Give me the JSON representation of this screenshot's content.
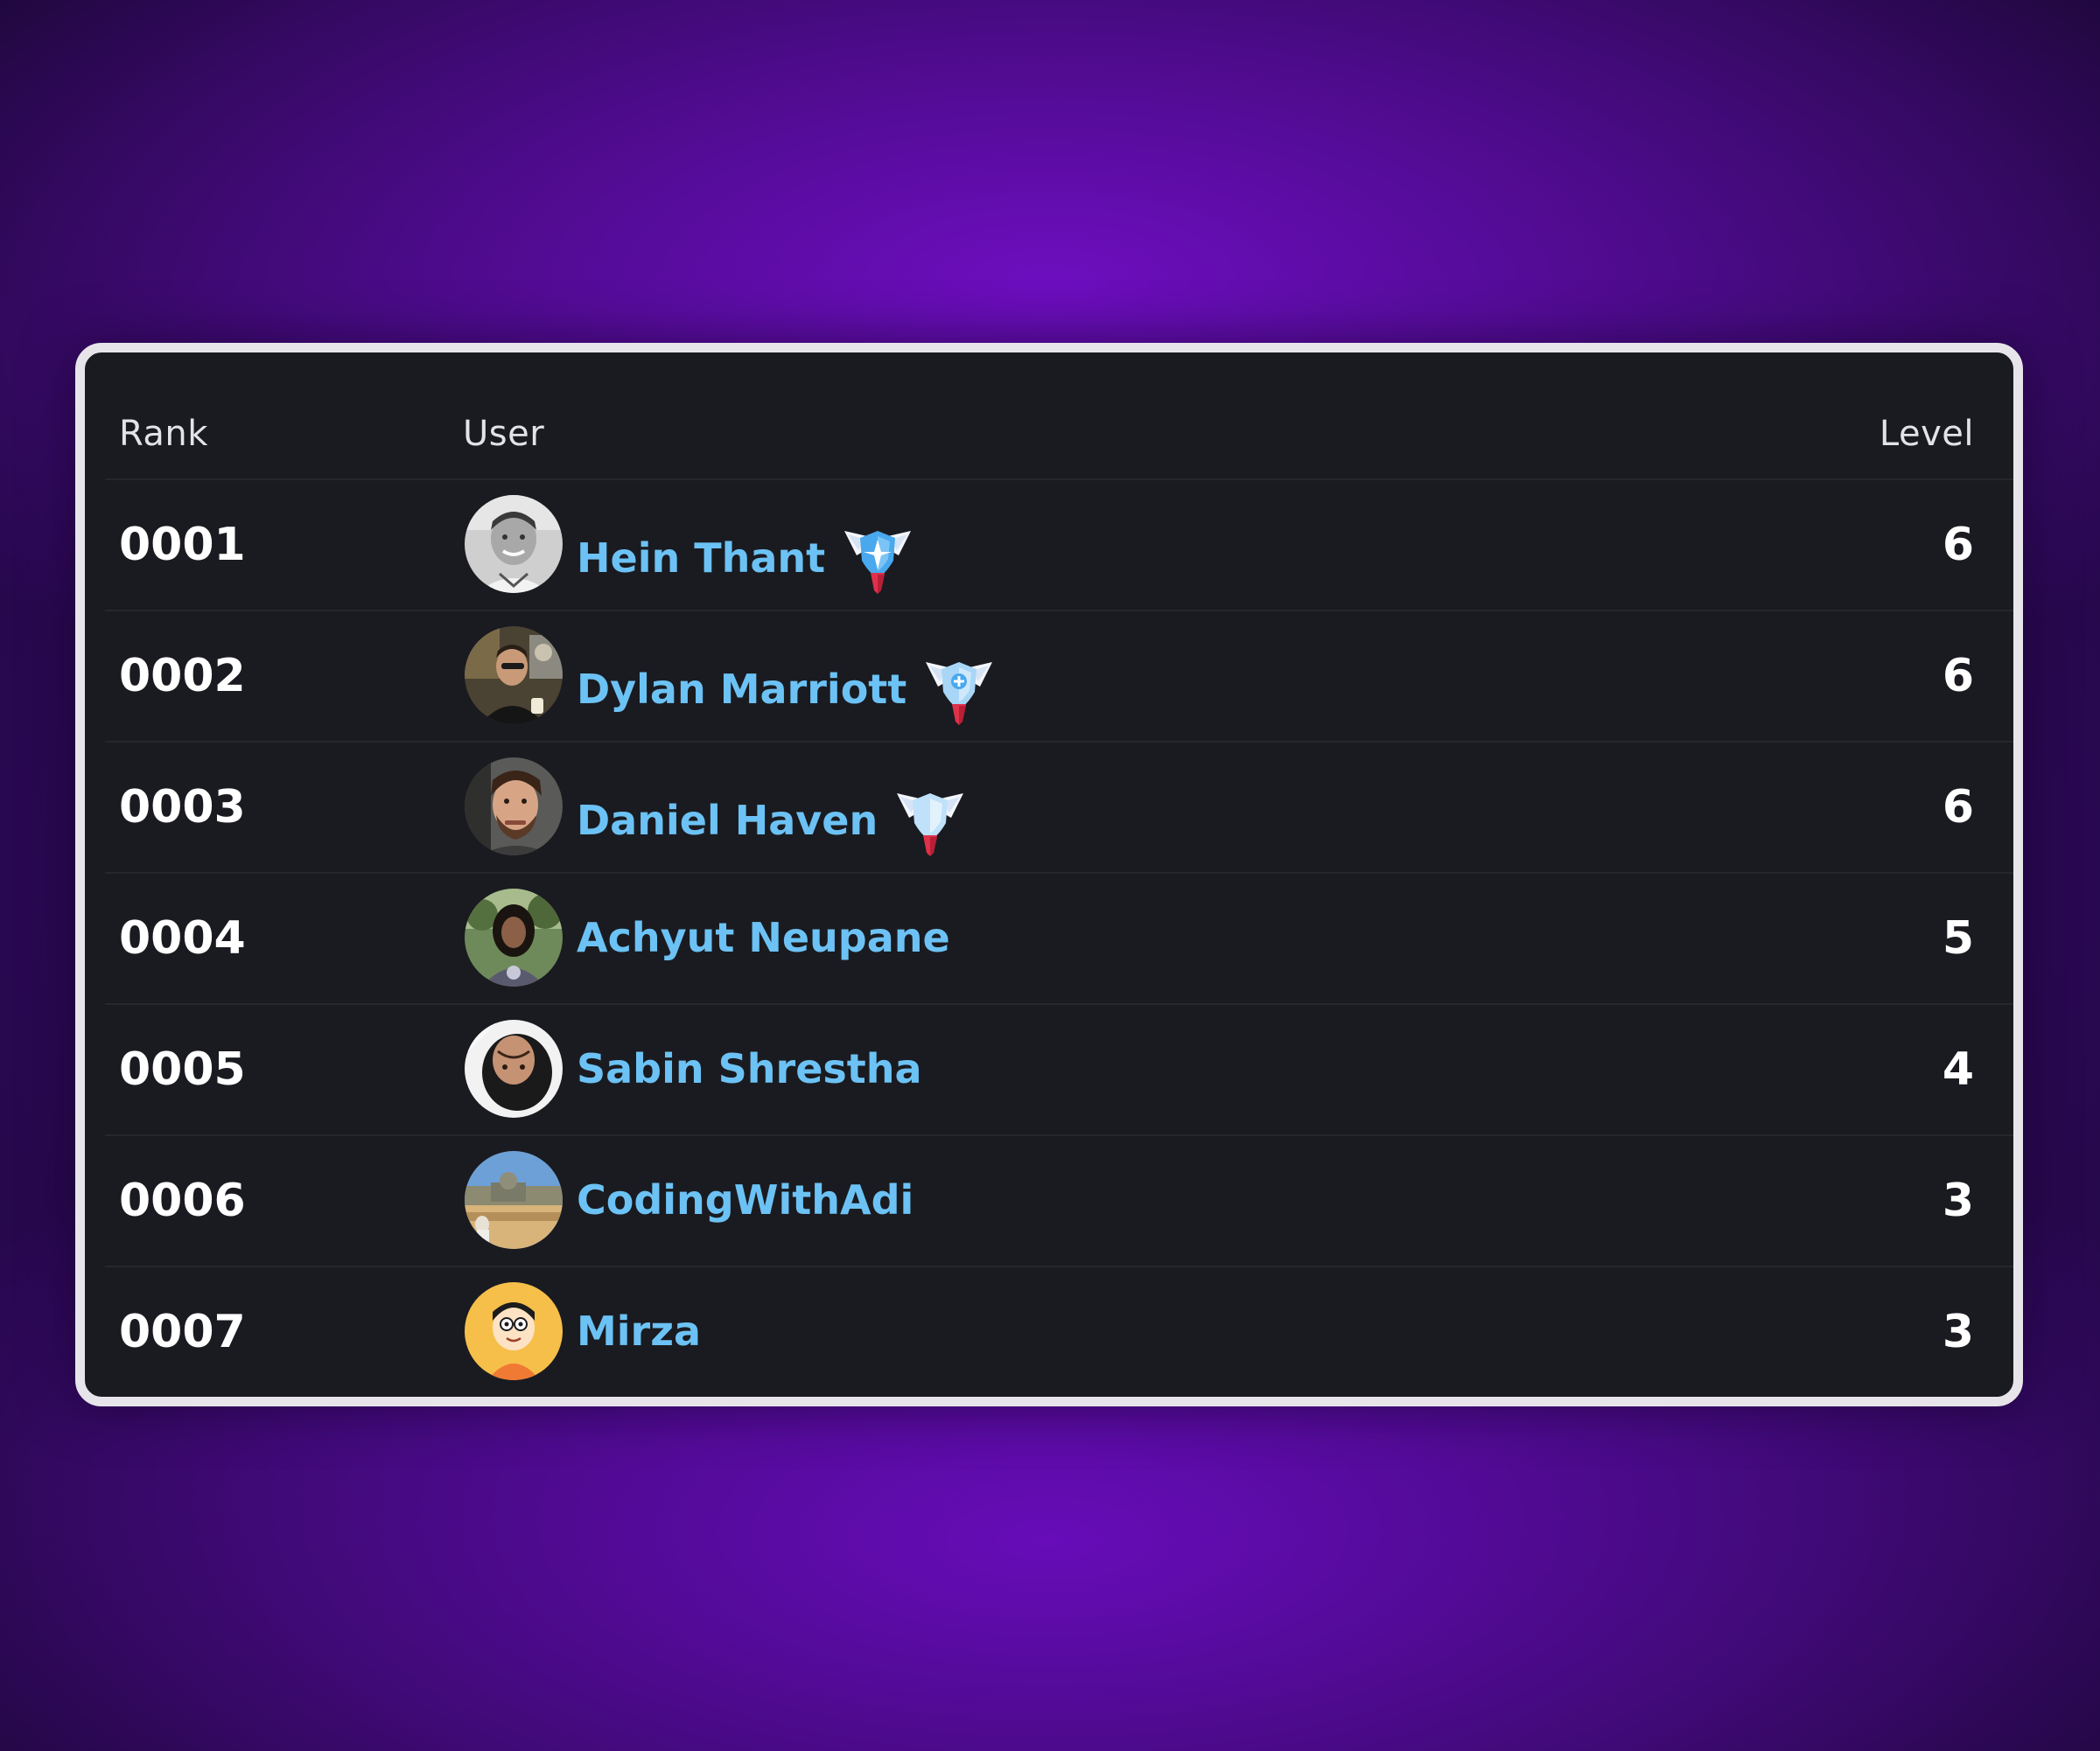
{
  "table": {
    "headers": {
      "rank": "Rank",
      "user": "User",
      "level": "Level"
    },
    "rows": [
      {
        "rank": "0001",
        "name": "Hein Thant",
        "level": "6",
        "badge": "winged-shield-badge-icon",
        "avatar": "photo-grayscale-man"
      },
      {
        "rank": "0002",
        "name": "Dylan Marriott",
        "level": "6",
        "badge": "winged-shield-badge-icon",
        "avatar": "photo-man-cafe"
      },
      {
        "rank": "0003",
        "name": "Daniel Haven",
        "level": "6",
        "badge": "winged-shield-badge-icon",
        "avatar": "photo-man-beard"
      },
      {
        "rank": "0004",
        "name": "Achyut Neupane",
        "level": "5",
        "avatar": "photo-person-outdoors"
      },
      {
        "rank": "0005",
        "name": "Sabin Shrestha",
        "level": "4",
        "avatar": "photo-upside-down-face"
      },
      {
        "rank": "0006",
        "name": "CodingWithAdi",
        "level": "3",
        "avatar": "photo-landscape"
      },
      {
        "rank": "0007",
        "name": "Mirza",
        "level": "3",
        "avatar": "cartoon-boy-yellow"
      }
    ]
  },
  "colors": {
    "username": "#6cc2f4",
    "panel_bg": "#1a1b20",
    "panel_border": "#e7e5ea",
    "page_bg_accent": "#6a0cbe"
  }
}
